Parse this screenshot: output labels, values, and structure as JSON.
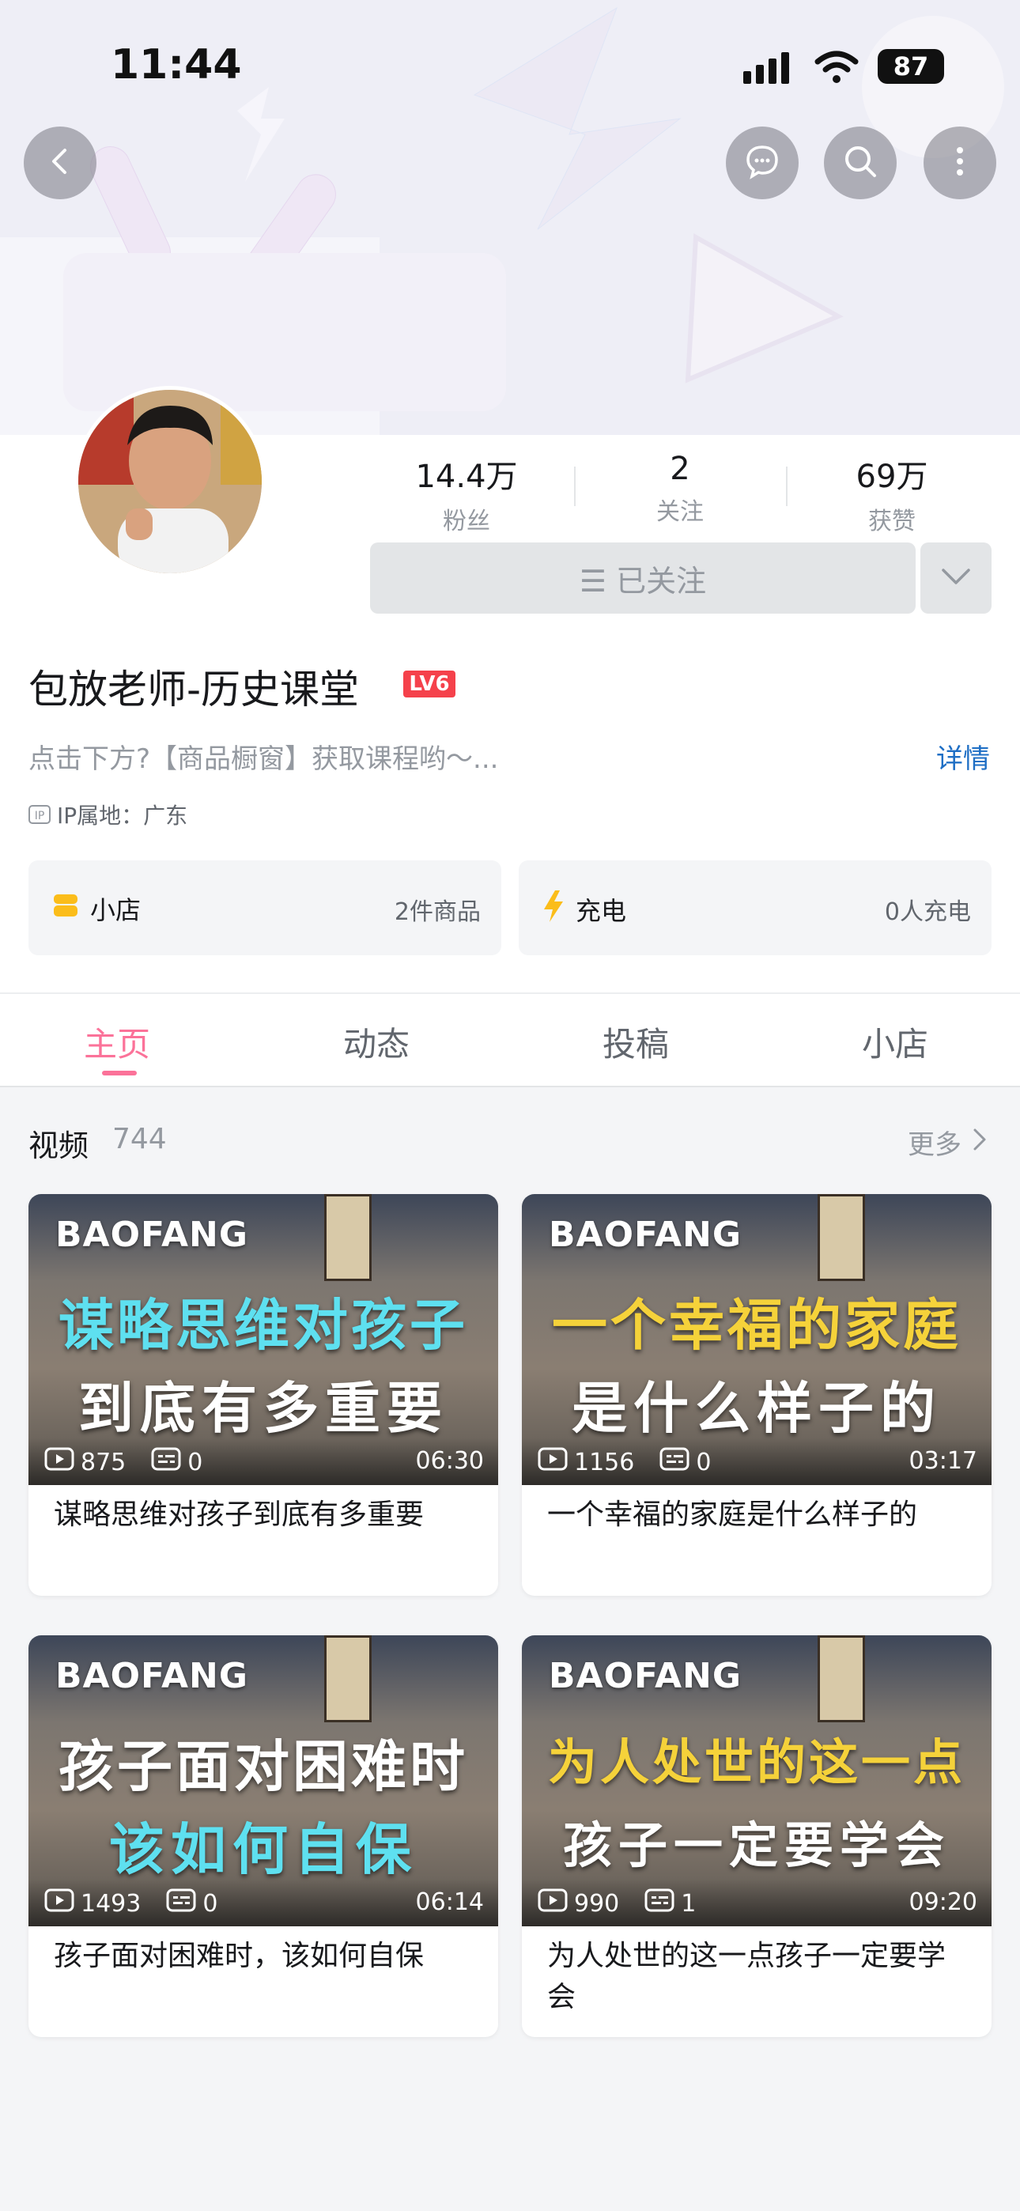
{
  "status": {
    "time": "11:44",
    "battery": "87"
  },
  "header": {
    "back_icon": "back-icon",
    "message_icon": "message-icon",
    "search_icon": "search-icon",
    "more_icon": "more-vertical-icon"
  },
  "profile": {
    "stats": [
      {
        "value": "14.4万",
        "label": "粉丝"
      },
      {
        "value": "2",
        "label": "关注"
      },
      {
        "value": "69万",
        "label": "获赞"
      }
    ],
    "follow_label": "☰ 已关注",
    "name": "包放老师-历史课堂",
    "level": "LV6",
    "signature": "点击下方?【商品橱窗】获取课程哟～...",
    "detail_link": "详情",
    "ip_label": "IP属地：广东"
  },
  "cards": {
    "shop": {
      "label": "小店",
      "info": "2件商品"
    },
    "charge": {
      "label": "充电",
      "info": "0人充电"
    }
  },
  "tabs": [
    "主页",
    "动态",
    "投稿",
    "小店"
  ],
  "videos_section": {
    "title": "视频",
    "count": "744",
    "more": "更多"
  },
  "videos": [
    {
      "brand": "BAOFANG",
      "line1": "谋略思维对孩子",
      "line1_color": "#5ee0f0",
      "line2": "到底有多重要",
      "plays": "875",
      "comments": "0",
      "duration": "06:30",
      "title": "谋略思维对孩子到底有多重要"
    },
    {
      "brand": "BAOFANG",
      "line1": "一个幸福的家庭",
      "line1_color": "#f5d23a",
      "line2": "是什么样子的",
      "plays": "1156",
      "comments": "0",
      "duration": "03:17",
      "title": "一个幸福的家庭是什么样子的"
    },
    {
      "brand": "BAOFANG",
      "line1": "孩子面对困难时",
      "line1_color": "#ffffff",
      "line2": "该如何自保",
      "line2_color": "#5ee0f0",
      "plays": "1493",
      "comments": "0",
      "duration": "06:14",
      "title": "孩子面对困难时，该如何自保"
    },
    {
      "brand": "BAOFANG",
      "line1": "为人处世的这一点",
      "line1_color": "#f5d23a",
      "line2": "孩子一定要学会",
      "plays": "990",
      "comments": "1",
      "duration": "09:20",
      "title": "为人处世的这一点孩子一定要学会"
    }
  ]
}
